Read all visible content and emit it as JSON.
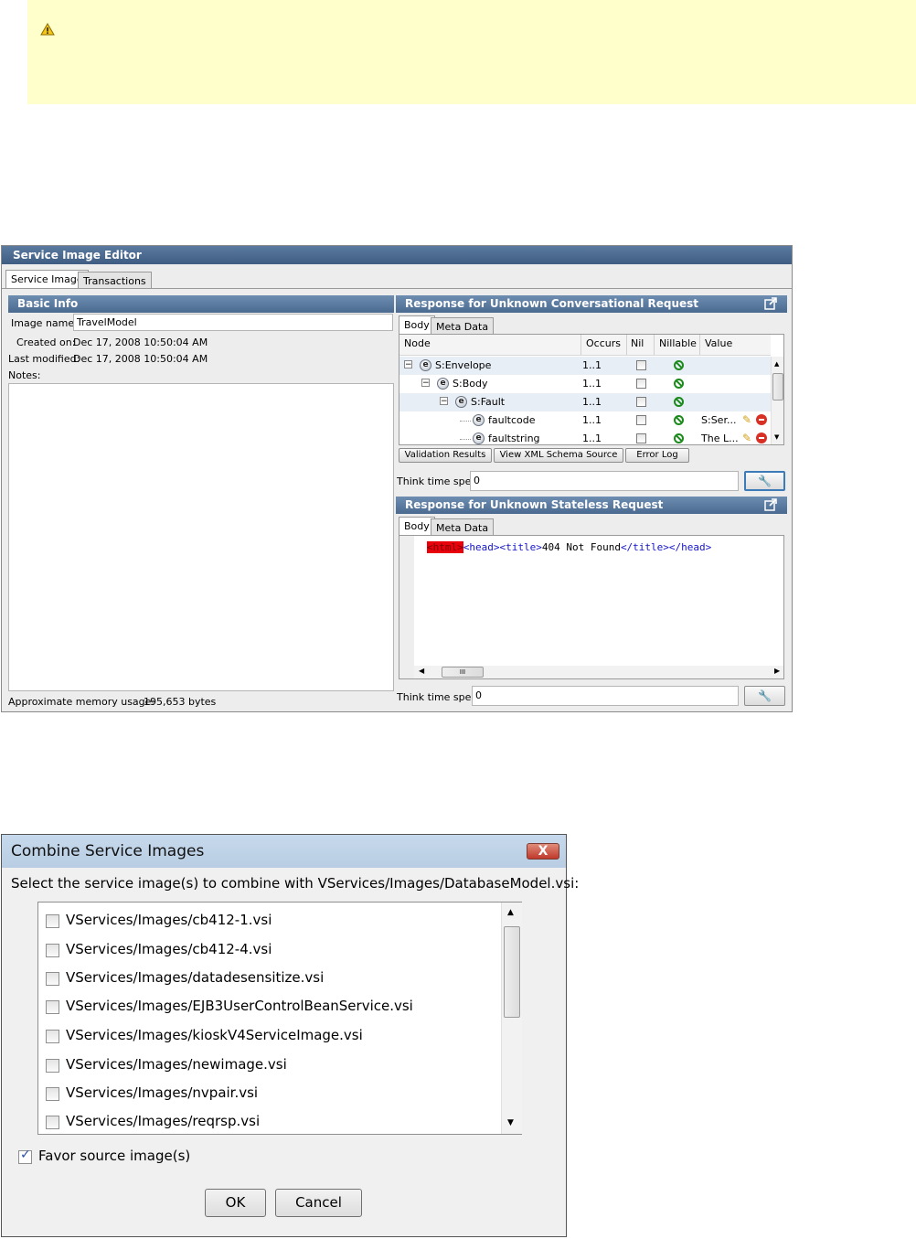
{
  "warning": {
    "icon": "warning-icon"
  },
  "sie": {
    "title": "Service Image Editor",
    "tabs": [
      "Service Image",
      "Transactions"
    ],
    "basic_info": {
      "header": "Basic Info",
      "image_name_label": "Image name:",
      "image_name_value": "TravelModel",
      "created_label": "Created on:",
      "created_value": "Dec 17, 2008 10:50:04 AM",
      "modified_label": "Last modified:",
      "modified_value": "Dec 17, 2008 10:50:04 AM",
      "notes_label": "Notes:",
      "memory_label": "Approximate memory usage:",
      "memory_value": "195,653 bytes"
    },
    "conv": {
      "header": "Response for Unknown Conversational Request",
      "tabs": [
        "Body",
        "Meta Data"
      ],
      "columns": [
        "Node",
        "Occurs",
        "Nil",
        "Nillable",
        "Value"
      ],
      "rows": [
        {
          "node": "S:Envelope",
          "occurs": "1..1",
          "value": ""
        },
        {
          "node": "S:Body",
          "occurs": "1..1",
          "value": ""
        },
        {
          "node": "S:Fault",
          "occurs": "1..1",
          "value": ""
        },
        {
          "node": "faultcode",
          "occurs": "1..1",
          "value": "S:Ser..."
        },
        {
          "node": "faultstring",
          "occurs": "1..1",
          "value": "The L..."
        }
      ],
      "buttons": [
        "Validation Results",
        "View XML Schema Source",
        "Error Log"
      ],
      "think_label": "Think time spec:",
      "think_value": "0"
    },
    "stateless": {
      "header": "Response for Unknown Stateless Request",
      "tabs": [
        "Body",
        "Meta Data"
      ],
      "code_tag": "<html>",
      "code_rest": "<head><title>",
      "code_text": "404 Not Found",
      "code_close": "</title></head>",
      "scroll_grip": "III",
      "think_label": "Think time spec:",
      "think_value": "0"
    }
  },
  "combine": {
    "title": "Combine Service Images",
    "close_label": "X",
    "instruction": "Select the service image(s) to combine with VServices/Images/DatabaseModel.vsi:",
    "items": [
      "VServices/Images/cb412-1.vsi",
      "VServices/Images/cb412-4.vsi",
      "VServices/Images/datadesensitize.vsi",
      "VServices/Images/EJB3UserControlBeanService.vsi",
      "VServices/Images/kioskV4ServiceImage.vsi",
      "VServices/Images/newimage.vsi",
      "VServices/Images/nvpair.vsi",
      "VServices/Images/reqrsp.vsi"
    ],
    "favor_label": "Favor source image(s)",
    "favor_checked": true,
    "ok_label": "OK",
    "cancel_label": "Cancel"
  }
}
